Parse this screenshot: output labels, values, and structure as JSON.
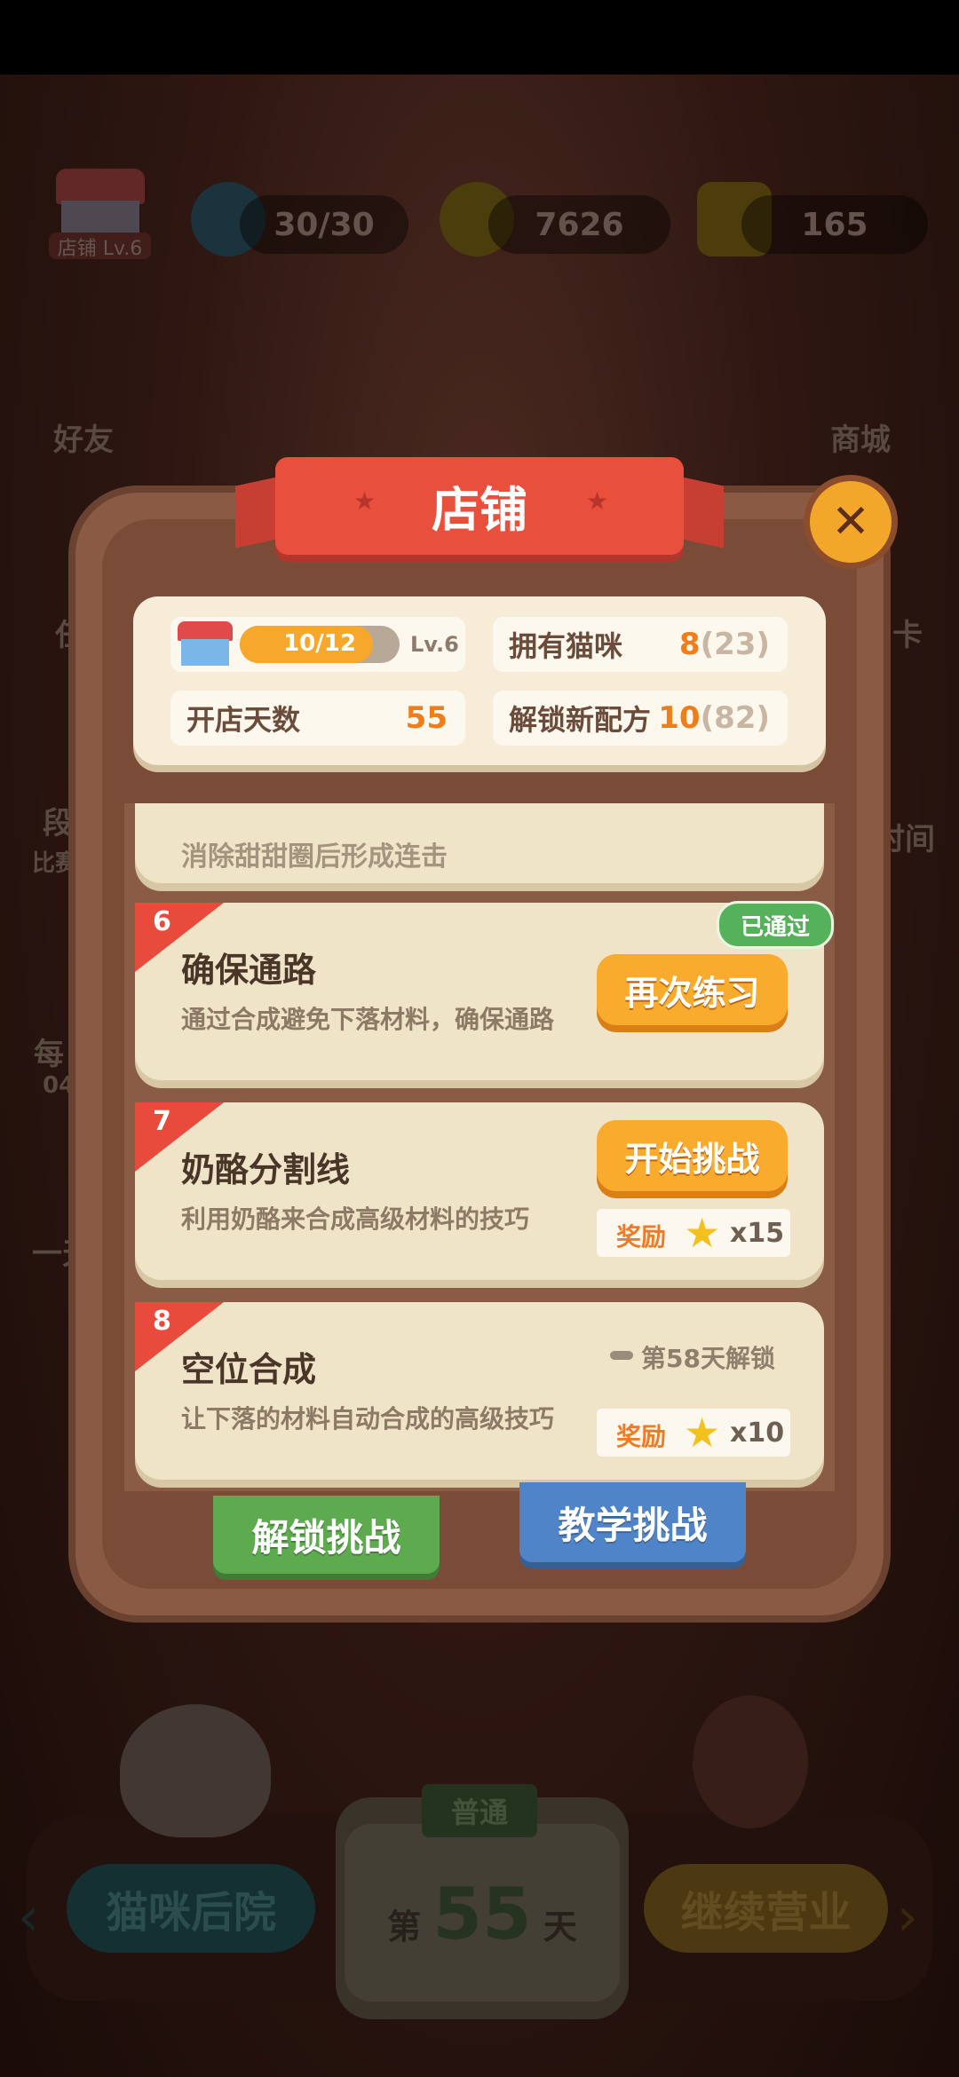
{
  "hud": {
    "shop_label": "店铺 Lv.6",
    "energy": "30/30",
    "coins": "7626",
    "stars": "165"
  },
  "side_menu": {
    "friends": "好友",
    "mall": "商城",
    "partial_left": [
      "任",
      "段",
      "比赛",
      "每",
      "04",
      "一天"
    ],
    "partial_right": [
      "卡",
      "时间"
    ]
  },
  "bottom": {
    "backyard": "猫咪后院",
    "continue": "继续营业",
    "mode": "普通",
    "day_prefix": "第",
    "day_num": "55",
    "day_suffix": "天"
  },
  "modal": {
    "title": "店铺",
    "progress": "10/12",
    "progress_fraction": 0.833,
    "level": "Lv.6",
    "stats": {
      "cats_label": "拥有猫咪",
      "cats_value": "8",
      "cats_total": "(23)",
      "days_label": "开店天数",
      "days_value": "55",
      "recipes_label": "解锁新配方",
      "recipes_value": "10",
      "recipes_total": "(82)"
    },
    "prev_card_desc": "消除甜甜圈后形成连击",
    "challenges": [
      {
        "num": "6",
        "title": "确保通路",
        "desc": "通过合成避免下落材料，确保通路",
        "status": "已通过",
        "button": "再次练习"
      },
      {
        "num": "7",
        "title": "奶酪分割线",
        "desc": "利用奶酪来合成高级材料的技巧",
        "button": "开始挑战",
        "reward_label": "奖励",
        "reward_count": "x15"
      },
      {
        "num": "8",
        "title": "空位合成",
        "desc": "让下落的材料自动合成的高级技巧",
        "lock_text": "第58天解锁",
        "reward_label": "奖励",
        "reward_count": "x10"
      }
    ],
    "tabs": {
      "unlock": "解锁挑战",
      "teach": "教学挑战"
    }
  },
  "colors": {
    "ribbon": "#e84f3d",
    "orange_button": "#f9ab2e",
    "passed_green": "#55b15a",
    "tab_green": "#5eaa4e",
    "tab_blue": "#4f85c8"
  }
}
